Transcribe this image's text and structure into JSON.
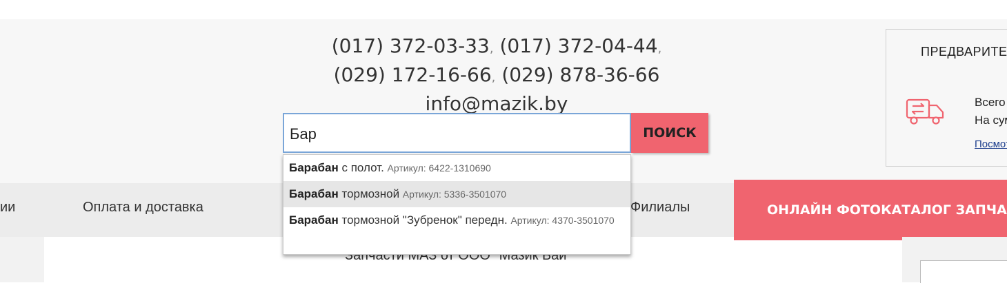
{
  "contacts": {
    "phone1": "(017) 372-03-33",
    "phone2": "(017) 372-04-44",
    "phone3": "(029) 172-16-66",
    "phone4": "(029) 878-36-66",
    "separator": ",",
    "email": "info@mazik.by"
  },
  "search": {
    "value": "Бар",
    "button_label": "ПОИСК"
  },
  "autocomplete": [
    {
      "match": "Барабан",
      "rest": " с полот.",
      "article": "Артикул: 6422-1310690"
    },
    {
      "match": "Барабан",
      "rest": " тормозной",
      "article": "Артикул: 5336-3501070"
    },
    {
      "match": "Барабан",
      "rest": " тормозной \"Зубренок\" передн.",
      "article": "Артикул: 4370-3501070"
    }
  ],
  "nav": {
    "item_partial": "ии",
    "payment": "Оплата и доставка",
    "branches": "Филиалы",
    "photo_catalog": "ОНЛАЙН ФОТОКАТАЛОГ ЗАПЧАСТЕЙ"
  },
  "cart": {
    "title": "ПРЕДВАРИТЕЛЬНЫЙ ЗАКАЗ",
    "line1": "Всего",
    "line2": "На сумму",
    "link": "Посмотреть",
    "icon": "truck-exchange-icon"
  },
  "content": {
    "text": "Запчасти МАЗ от ООО \"Мазик Бай\""
  },
  "colors": {
    "accent": "#f0646f",
    "search_border": "#7aa6d8",
    "link": "#1a3c8c"
  }
}
